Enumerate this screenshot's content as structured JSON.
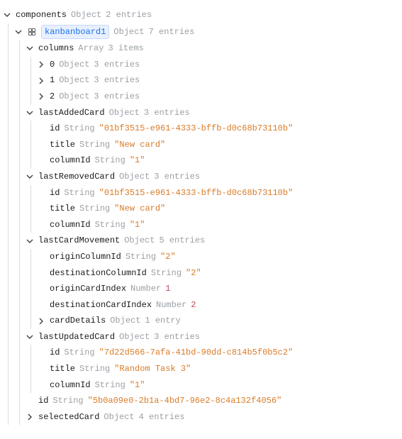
{
  "type_labels": {
    "object": "Object",
    "array": "Array",
    "string": "String",
    "number": "Number"
  },
  "unit_labels": {
    "entries": "entries",
    "entry": "entry",
    "items": "items"
  },
  "root": {
    "key": "components",
    "type": "Object",
    "count": 2,
    "count_unit": "entries",
    "expanded": true
  },
  "kanban": {
    "key": "kanbanboard1",
    "type": "Object",
    "count": 7,
    "count_unit": "entries",
    "expanded": true,
    "columns": {
      "key": "columns",
      "type": "Array",
      "count": 3,
      "count_unit": "items",
      "expanded": true,
      "items": [
        {
          "key": "0",
          "type": "Object",
          "count": 3,
          "count_unit": "entries",
          "expanded": false
        },
        {
          "key": "1",
          "type": "Object",
          "count": 3,
          "count_unit": "entries",
          "expanded": false
        },
        {
          "key": "2",
          "type": "Object",
          "count": 3,
          "count_unit": "entries",
          "expanded": false
        }
      ]
    },
    "lastAddedCard": {
      "key": "lastAddedCard",
      "type": "Object",
      "count": 3,
      "count_unit": "entries",
      "expanded": true,
      "id": {
        "key": "id",
        "type": "String",
        "value": "\"01bf3515-e961-4333-bffb-d0c68b73110b\""
      },
      "title": {
        "key": "title",
        "type": "String",
        "value": "\"New card\""
      },
      "columnId": {
        "key": "columnId",
        "type": "String",
        "value": "\"1\""
      }
    },
    "lastRemovedCard": {
      "key": "lastRemovedCard",
      "type": "Object",
      "count": 3,
      "count_unit": "entries",
      "expanded": true,
      "id": {
        "key": "id",
        "type": "String",
        "value": "\"01bf3515-e961-4333-bffb-d0c68b73110b\""
      },
      "title": {
        "key": "title",
        "type": "String",
        "value": "\"New card\""
      },
      "columnId": {
        "key": "columnId",
        "type": "String",
        "value": "\"1\""
      }
    },
    "lastCardMovement": {
      "key": "lastCardMovement",
      "type": "Object",
      "count": 5,
      "count_unit": "entries",
      "expanded": true,
      "originColumnId": {
        "key": "originColumnId",
        "type": "String",
        "value": "\"2\""
      },
      "destinationColumnId": {
        "key": "destinationColumnId",
        "type": "String",
        "value": "\"2\""
      },
      "originCardIndex": {
        "key": "originCardIndex",
        "type": "Number",
        "value": "1"
      },
      "destinationCardIndex": {
        "key": "destinationCardIndex",
        "type": "Number",
        "value": "2"
      },
      "cardDetails": {
        "key": "cardDetails",
        "type": "Object",
        "count": 1,
        "count_unit": "entry",
        "expanded": false
      }
    },
    "lastUpdatedCard": {
      "key": "lastUpdatedCard",
      "type": "Object",
      "count": 3,
      "count_unit": "entries",
      "expanded": true,
      "id": {
        "key": "id",
        "type": "String",
        "value": "\"7d22d566-7afa-41bd-90dd-c814b5f0b5c2\""
      },
      "title": {
        "key": "title",
        "type": "String",
        "value": "\"Random Task 3\""
      },
      "columnId": {
        "key": "columnId",
        "type": "String",
        "value": "\"1\""
      }
    },
    "id": {
      "key": "id",
      "type": "String",
      "value": "\"5b0a09e0-2b1a-4bd7-96e2-8c4a132f4056\""
    },
    "selectedCard": {
      "key": "selectedCard",
      "type": "Object",
      "count": 4,
      "count_unit": "entries",
      "expanded": false
    }
  }
}
